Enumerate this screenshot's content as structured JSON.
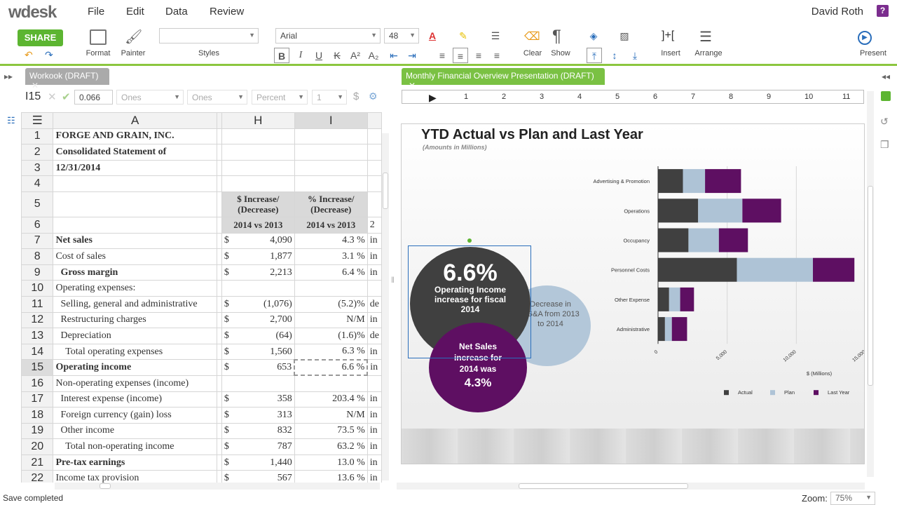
{
  "app": {
    "logo": "wdesk",
    "menu": [
      "File",
      "Edit",
      "Data",
      "Review"
    ],
    "user": "David Roth",
    "help": "?"
  },
  "ribbon": {
    "share": "SHARE",
    "format": "Format",
    "painter": "Painter",
    "styles": "Styles",
    "font": "Arial",
    "font_size": "48",
    "clear": "Clear",
    "show": "Show",
    "insert": "Insert",
    "arrange": "Arrange",
    "present": "Present"
  },
  "workbook": {
    "tab": "Workook (DRAFT)",
    "cell_ref": "I15",
    "cell_value": "0.066",
    "fmt1": "Ones",
    "fmt2": "Ones",
    "fmt3": "Percent",
    "fmt4": "1",
    "currency": "$"
  },
  "grid": {
    "col_a": "A",
    "col_h": "H",
    "col_i": "I",
    "rows": [
      {
        "n": "1",
        "a": "FORGE AND GRAIN, INC.",
        "a_bold": true,
        "h1": "",
        "h2": "",
        "i": ""
      },
      {
        "n": "2",
        "a": "Consolidated Statement of",
        "a_bold": true,
        "h1": "",
        "h2": "",
        "i": ""
      },
      {
        "n": "3",
        "a": "12/31/2014",
        "a_bold": true,
        "h1": "",
        "h2": "",
        "i": ""
      },
      {
        "n": "4",
        "a": "",
        "h1": "",
        "h2": "",
        "i": ""
      },
      {
        "n": "5",
        "a": "",
        "h1": "",
        "h2": "$ Increase/ (Decrease)",
        "i": "% Increase/ (Decrease)",
        "j": "",
        "shade": true
      },
      {
        "n": "6",
        "a": "",
        "h1": "",
        "h2": "2014 vs 2013",
        "i": "2014 vs 2013",
        "j": "2",
        "shade": true
      },
      {
        "n": "7",
        "a": "Net sales",
        "a_bold": true,
        "h1": "$",
        "h2": "4,090",
        "i": "4.3 %",
        "j": "in"
      },
      {
        "n": "8",
        "a": "Cost of sales",
        "h1": "$",
        "h2": "1,877",
        "i": "3.1 %",
        "j": "in"
      },
      {
        "n": "9",
        "a": "  Gross margin",
        "a_bold": true,
        "h1": "$",
        "h2": "2,213",
        "i": "6.4 %",
        "j": "in"
      },
      {
        "n": "10",
        "a": "Operating expenses:",
        "h1": "",
        "h2": "",
        "i": "",
        "j": ""
      },
      {
        "n": "11",
        "a": "  Selling, general and administrative",
        "h1": "$",
        "h2": "(1,076)",
        "i": "(5.2)%",
        "j": "de"
      },
      {
        "n": "12",
        "a": "  Restructuring charges",
        "h1": "$",
        "h2": "2,700",
        "i": "N/M",
        "j": "in"
      },
      {
        "n": "13",
        "a": "  Depreciation",
        "h1": "$",
        "h2": "(64)",
        "i": "(1.6)%",
        "j": "de"
      },
      {
        "n": "14",
        "a": "    Total operating expenses",
        "h1": "$",
        "h2": "1,560",
        "i": "6.3 %",
        "j": "in"
      },
      {
        "n": "15",
        "a": "Operating income",
        "a_bold": true,
        "h1": "$",
        "h2": "653",
        "i": "6.6 %",
        "j": "in"
      },
      {
        "n": "16",
        "a": "Non-operating expenses (income)",
        "h1": "",
        "h2": "",
        "i": "",
        "j": ""
      },
      {
        "n": "17",
        "a": "  Interest expense (income)",
        "h1": "$",
        "h2": "358",
        "i": "203.4 %",
        "j": "in"
      },
      {
        "n": "18",
        "a": "  Foreign currency (gain) loss",
        "h1": "$",
        "h2": "313",
        "i": "N/M",
        "j": "in"
      },
      {
        "n": "19",
        "a": "  Other income",
        "h1": "$",
        "h2": "832",
        "i": "73.5 %",
        "j": "in"
      },
      {
        "n": "20",
        "a": "    Total non-operating income",
        "h1": "$",
        "h2": "787",
        "i": "63.2 %",
        "j": "in"
      },
      {
        "n": "21",
        "a": "Pre-tax earnings",
        "a_bold": true,
        "h1": "$",
        "h2": "1,440",
        "i": "13.0 %",
        "j": "in"
      },
      {
        "n": "22",
        "a": "Income tax provision",
        "h1": "$",
        "h2": "567",
        "i": "13.6 %",
        "j": "in"
      }
    ]
  },
  "presentation": {
    "tab": "Monthly Financial Overview Presentation (DRAFT)",
    "ruler_marks": [
      "1",
      "2",
      "3",
      "4",
      "5",
      "6",
      "7",
      "8",
      "9",
      "10",
      "11"
    ],
    "title": "YTD Actual vs Plan and Last Year",
    "subtitle": "(Amounts in Millions)",
    "circle1_big": "6.6%",
    "circle1_text": "Operating Income increase for fiscal 2014",
    "circle2_text": "Decrease in SG&A from 2013 to 2014",
    "circle3_text1": "Net Sales increase for 2014 was",
    "circle3_big": "4.3%",
    "colors": {
      "actual": "#404040",
      "plan": "#aec3d6",
      "last_year": "#5e0f62",
      "circle2": "#b3c7d9"
    }
  },
  "chart_data": {
    "type": "bar",
    "orientation": "horizontal",
    "stacked": true,
    "categories": [
      "Advertising & Promotion",
      "Operations",
      "Occupancy",
      "Personnel Costs",
      "Other Expense",
      "Administrative"
    ],
    "series": [
      {
        "name": "Actual",
        "values": [
          1800,
          2900,
          2200,
          5700,
          800,
          500
        ]
      },
      {
        "name": "Plan",
        "values": [
          1600,
          3200,
          2200,
          5500,
          800,
          500
        ]
      },
      {
        "name": "Last Year",
        "values": [
          2600,
          2800,
          2100,
          3000,
          1000,
          1100
        ]
      }
    ],
    "xlabel": "$ (Millions)",
    "xticks": [
      "0",
      "5,000",
      "10,000",
      "15,000"
    ],
    "xlim": [
      0,
      15000
    ],
    "legend": "bottom",
    "legend_labels": [
      "Actual",
      "Plan",
      "Last Year"
    ]
  },
  "status": {
    "message": "Save completed",
    "zoom_label": "Zoom:",
    "zoom": "75%"
  }
}
